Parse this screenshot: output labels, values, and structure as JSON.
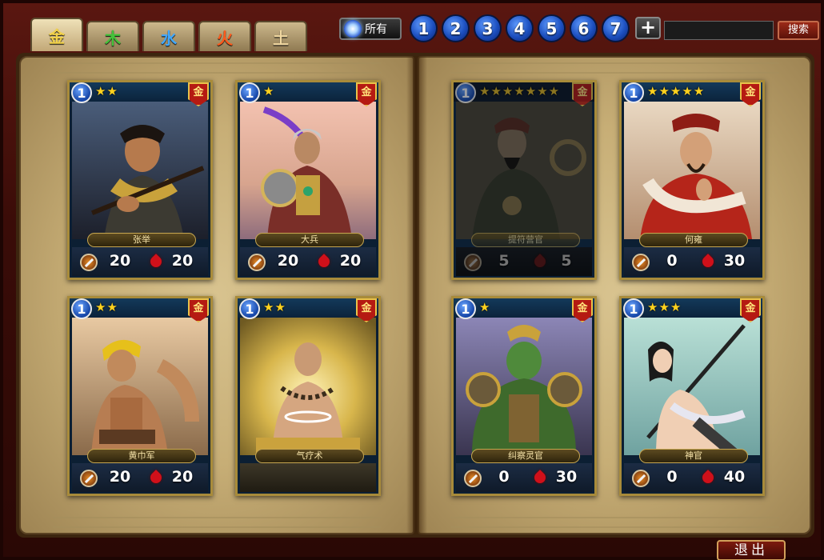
{
  "element_tabs": [
    {
      "label": "金",
      "color": "#f2d24a"
    },
    {
      "label": "木",
      "color": "#44c23a"
    },
    {
      "label": "水",
      "color": "#41a8ff"
    },
    {
      "label": "火",
      "color": "#ff5a1c"
    },
    {
      "label": "土",
      "color": "#f0d7a0"
    }
  ],
  "toolbar": {
    "all_label": "所有",
    "levels": [
      "1",
      "2",
      "3",
      "4",
      "5",
      "6",
      "7"
    ],
    "plus_label": "+",
    "search_value": "",
    "search_label": "搜索"
  },
  "cards": [
    {
      "level": "1",
      "stars": "★★",
      "element": "金",
      "name": "张举",
      "attack": "20",
      "hp": "20",
      "dim": false,
      "art": "warrior1"
    },
    {
      "level": "1",
      "stars": "★",
      "element": "金",
      "name": "大兵",
      "attack": "20",
      "hp": "20",
      "dim": false,
      "art": "warrior2"
    },
    {
      "level": "1",
      "stars": "★★",
      "element": "金",
      "name": "黄巾军",
      "attack": "20",
      "hp": "20",
      "dim": false,
      "art": "warrior3"
    },
    {
      "level": "1",
      "stars": "★★",
      "element": "金",
      "name": "气疗术",
      "attack": "",
      "hp": "",
      "dim": false,
      "art": "monk"
    },
    {
      "level": "1",
      "stars": "★★★★★★★",
      "element": "金",
      "name": "提符营官",
      "attack": "5",
      "hp": "5",
      "dim": true,
      "art": "lord"
    },
    {
      "level": "1",
      "stars": "★★★★★",
      "element": "金",
      "name": "何雍",
      "attack": "0",
      "hp": "30",
      "dim": false,
      "art": "strategist"
    },
    {
      "level": "1",
      "stars": "★",
      "element": "金",
      "name": "纠察灵官",
      "attack": "0",
      "hp": "30",
      "dim": false,
      "art": "ogre"
    },
    {
      "level": "1",
      "stars": "★★★",
      "element": "金",
      "name": "神官",
      "attack": "0",
      "hp": "40",
      "dim": false,
      "art": "maiden"
    }
  ],
  "exit_label": "退出"
}
